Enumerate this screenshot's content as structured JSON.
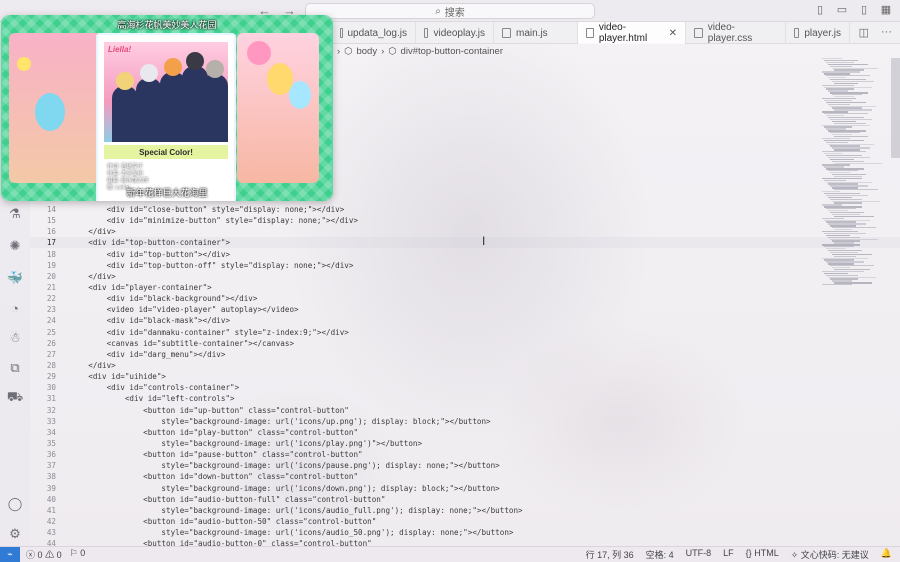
{
  "titlebar": {
    "search_label": "搜索"
  },
  "tabs": [
    {
      "label": "updata_log.js",
      "icon": "js"
    },
    {
      "label": "videoplay.js",
      "icon": "js"
    },
    {
      "label": "main.js",
      "icon": "js"
    },
    {
      "label": "video-player.html",
      "icon": "html",
      "active": true
    },
    {
      "label": "video-player.css",
      "icon": "css"
    },
    {
      "label": "player.js",
      "icon": "js"
    }
  ],
  "breadcrumb": {
    "items": [
      "body",
      "div#top-button-container"
    ]
  },
  "editor": {
    "current_line": 17,
    "lines": [
      {
        "n": "14",
        "text": "        <div id=\"close-button\" style=\"display: none;\"></div>"
      },
      {
        "n": "15",
        "text": "        <div id=\"minimize-button\" style=\"display: none;\"></div>"
      },
      {
        "n": "16",
        "text": "    </div>"
      },
      {
        "n": "17",
        "text": "    <div id=\"top-button-container\">"
      },
      {
        "n": "18",
        "text": "        <div id=\"top-button\"></div>"
      },
      {
        "n": "19",
        "text": "        <div id=\"top-button-off\" style=\"display: none;\"></div>"
      },
      {
        "n": "20",
        "text": "    </div>"
      },
      {
        "n": "21",
        "text": "    <div id=\"player-container\">"
      },
      {
        "n": "22",
        "text": "        <div id=\"black-background\"></div>"
      },
      {
        "n": "23",
        "text": "        <video id=\"video-player\" autoplay></video>"
      },
      {
        "n": "24",
        "text": "        <div id=\"black-mask\"></div>"
      },
      {
        "n": "25",
        "text": "        <div id=\"danmaku-container\" style=\"z-index:9;\"></div>"
      },
      {
        "n": "26",
        "text": "        <canvas id=\"subtitle-container\"></canvas>"
      },
      {
        "n": "27",
        "text": "        <div id=\"darg_menu\"></div>"
      },
      {
        "n": "28",
        "text": "    </div>"
      },
      {
        "n": "29",
        "text": "    <div id=\"uihide\">"
      },
      {
        "n": "30",
        "text": "        <div id=\"controls-container\">"
      },
      {
        "n": "31",
        "text": "            <div id=\"left-controls\">"
      },
      {
        "n": "32",
        "text": "                <button id=\"up-button\" class=\"control-button\""
      },
      {
        "n": "33",
        "text": "                    style=\"background-image: url('icons/up.png'); display: block;\"></button>"
      },
      {
        "n": "34",
        "text": "                <button id=\"play-button\" class=\"control-button\""
      },
      {
        "n": "35",
        "text": "                    style=\"background-image: url('icons/play.png')\"></button>"
      },
      {
        "n": "36",
        "text": "                <button id=\"pause-button\" class=\"control-button\""
      },
      {
        "n": "37",
        "text": "                    style=\"background-image: url('icons/pause.png'); display: none;\"></button>"
      },
      {
        "n": "38",
        "text": "                <button id=\"down-button\" class=\"control-button\""
      },
      {
        "n": "39",
        "text": "                    style=\"background-image: url('icons/down.png'); display: block;\"></button>"
      },
      {
        "n": "40",
        "text": "                <button id=\"audio-button-full\" class=\"control-button\""
      },
      {
        "n": "41",
        "text": "                    style=\"background-image: url('icons/audio_full.png'); display: none;\"></button>"
      },
      {
        "n": "42",
        "text": "                <button id=\"audio-button-50\" class=\"control-button\""
      },
      {
        "n": "43",
        "text": "                    style=\"background-image: url('icons/audio_50.png'); display: none;\"></button>"
      },
      {
        "n": "44",
        "text": "                <button id=\"audio-button-0\" class=\"control-button\""
      }
    ]
  },
  "pip": {
    "top_caption": "高海杉花帆美妙美人花园",
    "bottom_caption": "新年花样巨大花海里",
    "logo": "Liella!",
    "song_title": "Special Color!",
    "credits": [
      "作词: 宫嶋淳子",
      "作曲: 本多友纪",
      "编曲: 藤永龍太郎",
      "歌: Liella!"
    ]
  },
  "statusbar": {
    "errors": "0",
    "warnings": "0",
    "ports": "0",
    "position": "行 17, 列 36",
    "indent": "空格: 4",
    "encoding": "UTF-8",
    "eol": "LF",
    "language": "HTML",
    "extension": "文心快码: 无建议"
  },
  "colors": {
    "accent": "#2f7bd6",
    "pip_green": "#3fcf8f"
  }
}
